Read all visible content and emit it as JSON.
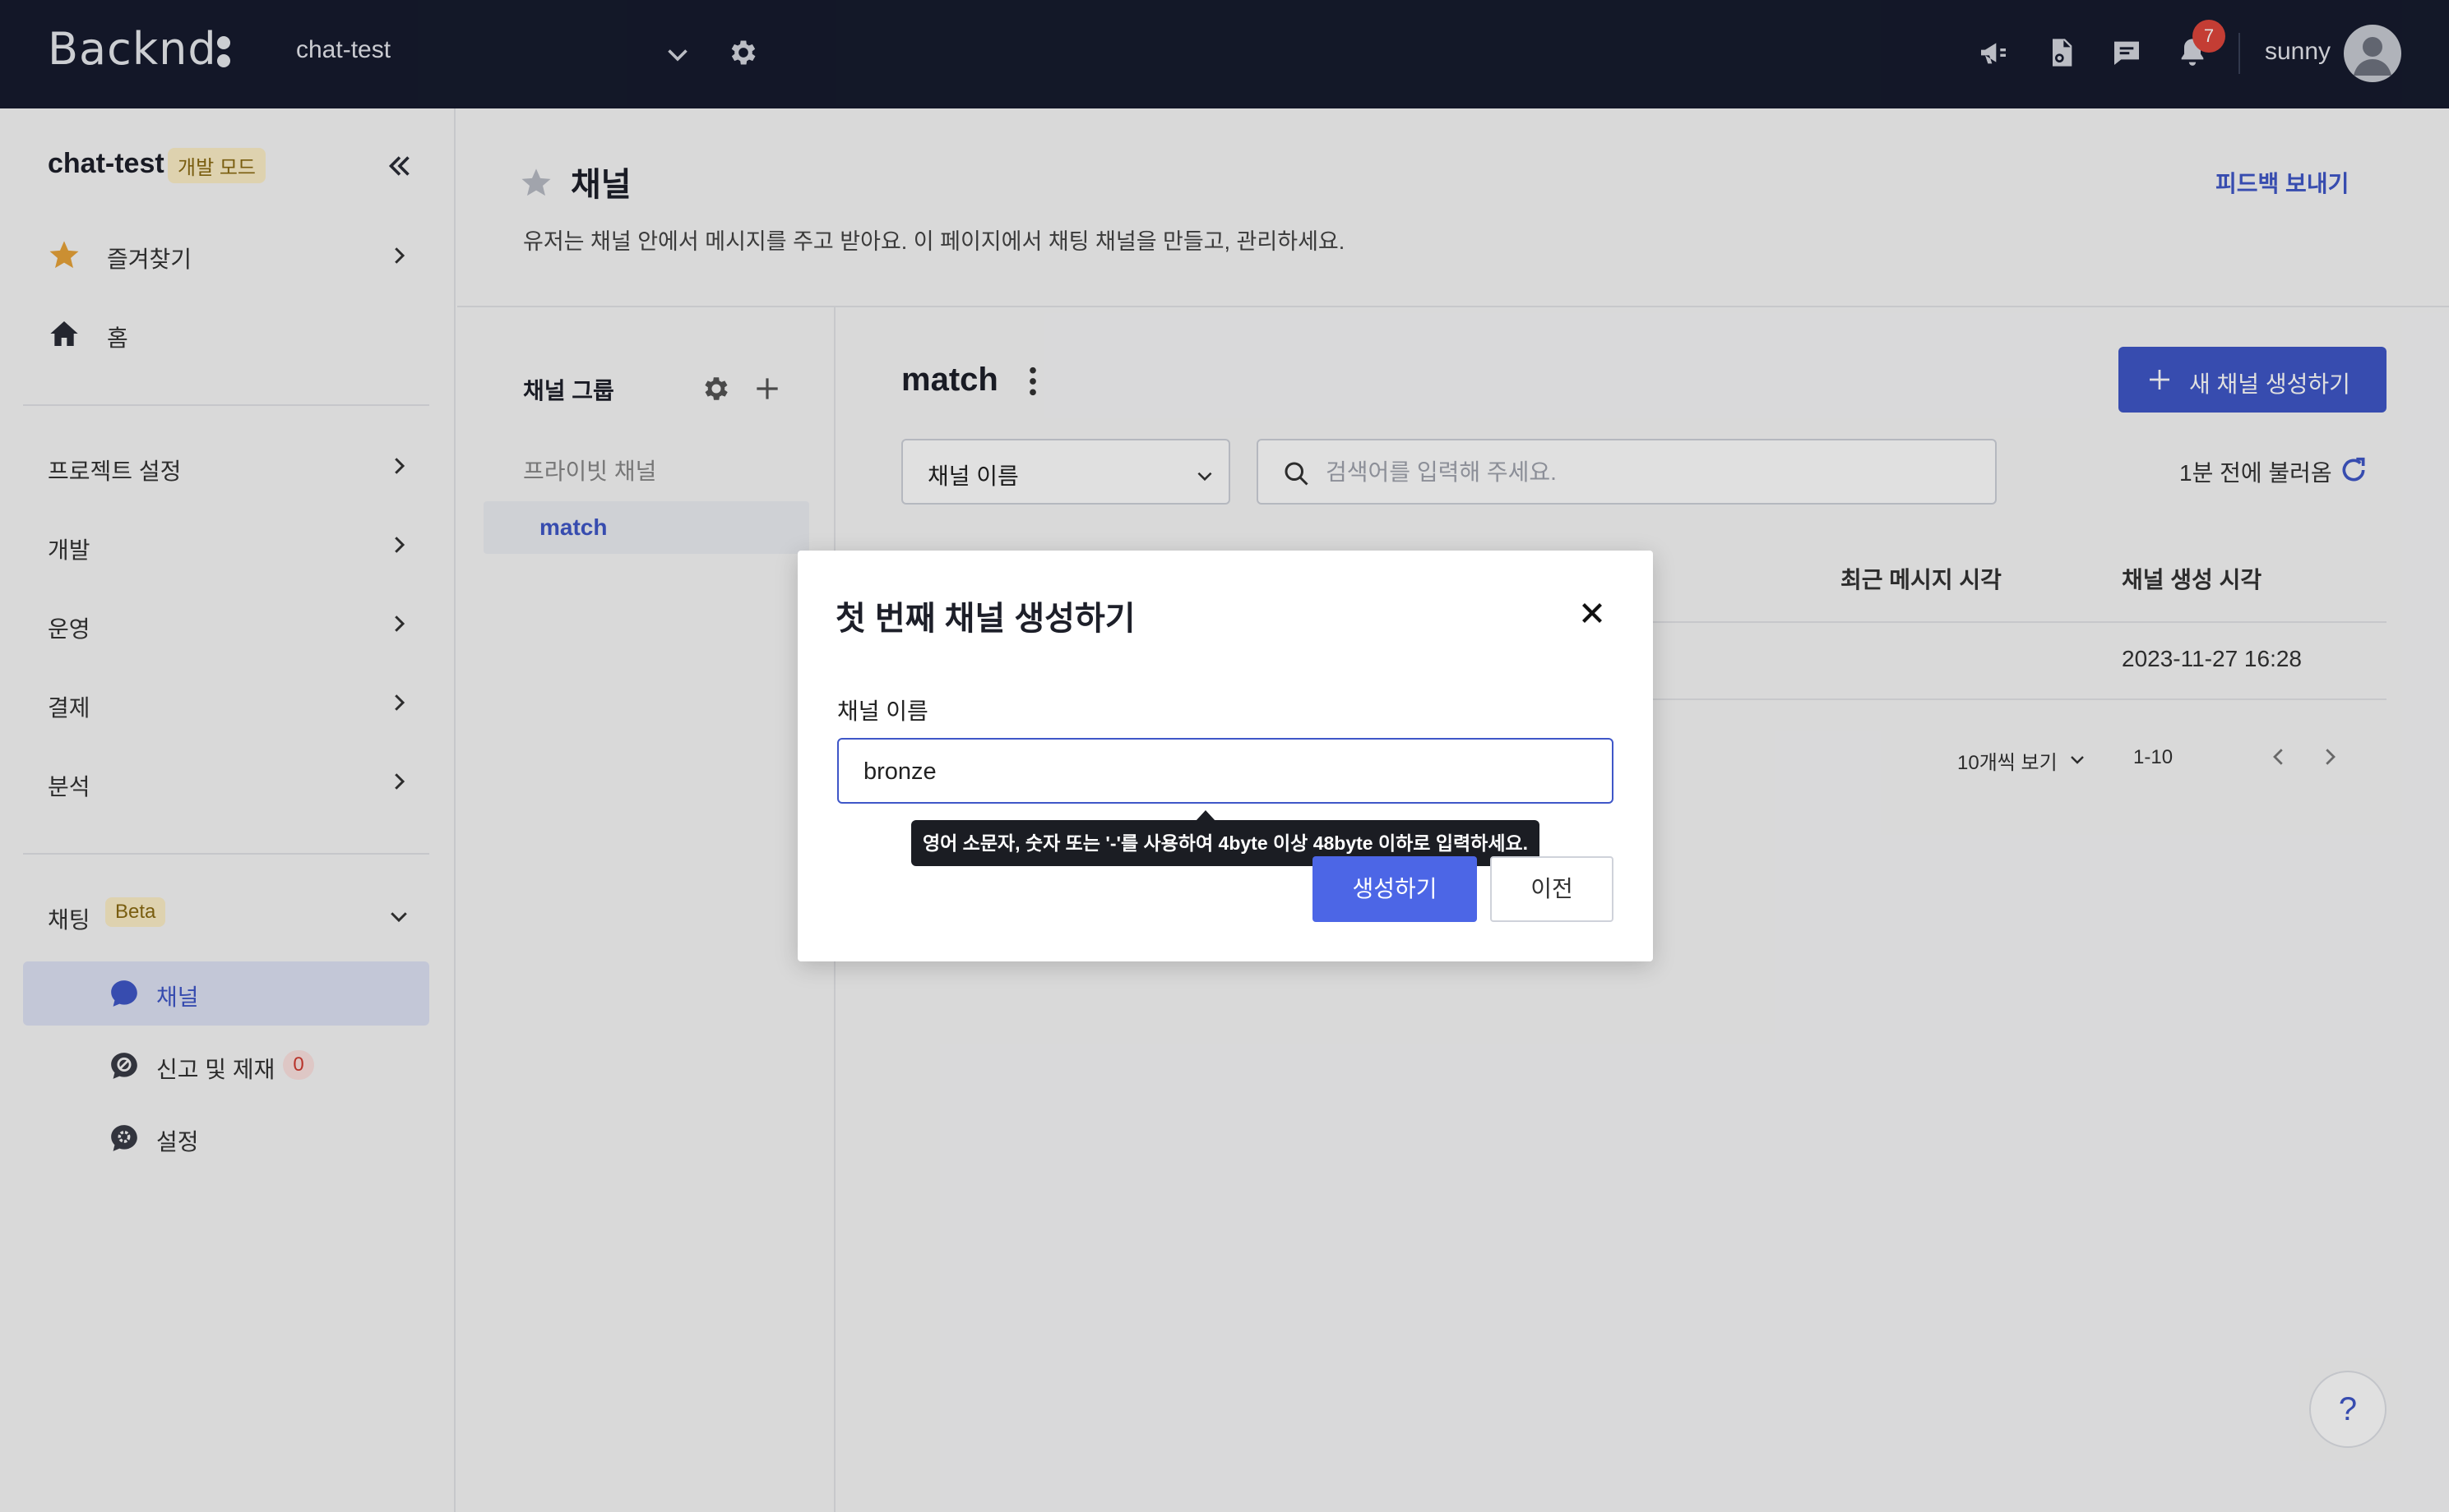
{
  "topbar": {
    "logo": "Backnd",
    "project": "chat-test",
    "notification_count": "7",
    "user": "sunny"
  },
  "sidebar": {
    "project": "chat-test",
    "dev_badge": "개발 모드",
    "favorites": "즐겨찾기",
    "home": "홈",
    "sections": [
      "프로젝트 설정",
      "개발",
      "운영",
      "결제",
      "분석"
    ],
    "chat": "채팅",
    "beta": "Beta",
    "sub_items": [
      "채널",
      "신고 및 제재",
      "설정"
    ],
    "report_count": "0"
  },
  "header": {
    "title": "채널",
    "description": "유저는 채널 안에서 메시지를 주고 받아요. 이 페이지에서 채팅 채널을 만들고, 관리하세요.",
    "feedback": "피드백 보내기"
  },
  "groups": {
    "title": "채널 그룹",
    "private_label": "프라이빗 채널",
    "active_group": "match"
  },
  "main": {
    "title": "match",
    "new_channel_button": "새 채널 생성하기",
    "filter_value": "채널 이름",
    "search_placeholder": "검색어를 입력해 주세요.",
    "refresh_text": "1분 전에 불러옴",
    "columns": [
      "최근 메시지 시각",
      "채널 생성 시각"
    ],
    "row": {
      "created_at": "2023-11-27 16:28"
    },
    "page_size": "10개씩 보기",
    "page_range": "1-10"
  },
  "modal": {
    "title": "첫 번째 채널 생성하기",
    "field_label": "채널 이름",
    "field_value": "bronze",
    "tooltip": "영어 소문자, 숫자 또는 '-'를 사용하여 4byte 이상 48byte 이하로 입력하세요.",
    "create_button": "생성하기",
    "back_button": "이전"
  },
  "help": "?",
  "colors": {
    "topbar": "#161b2e",
    "accent": "#3f57c8",
    "primary_button": "#4c66e6",
    "badge_red": "#e0463c",
    "star": "#e8a33a"
  }
}
